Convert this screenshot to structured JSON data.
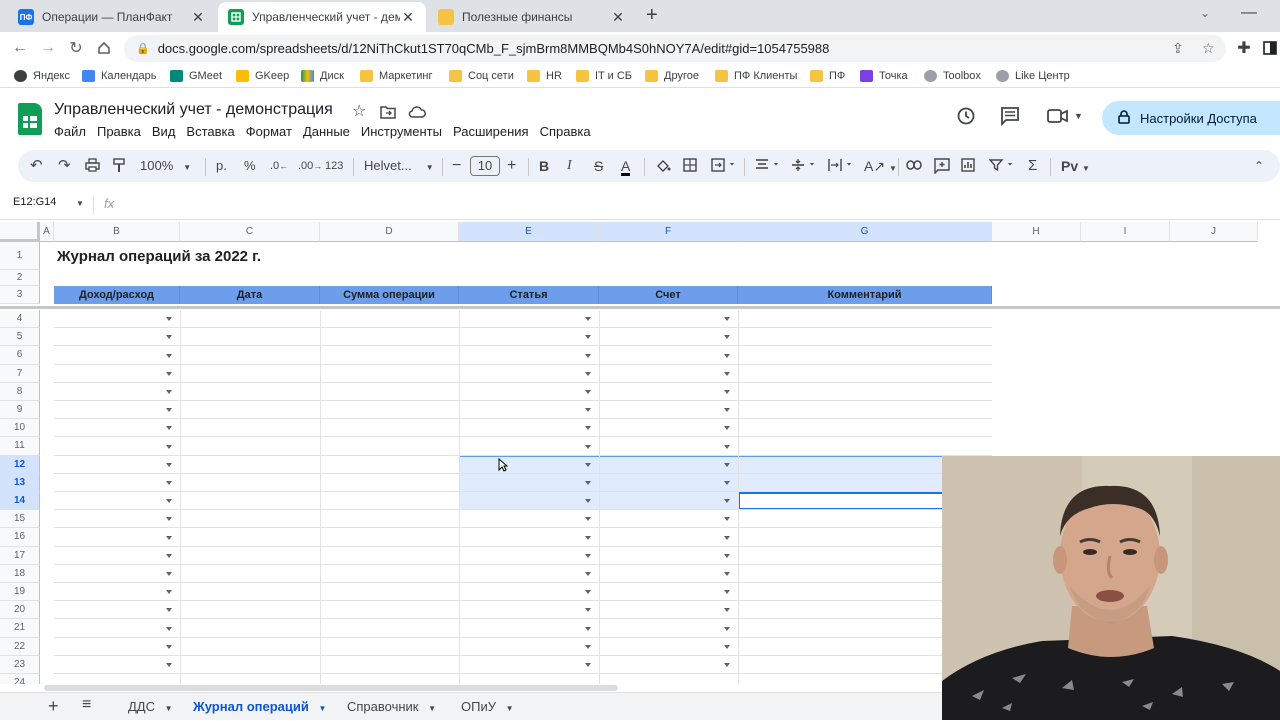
{
  "browser": {
    "tabs": [
      {
        "title": "Операции — ПланФакт",
        "favicon": "ПФ",
        "active": false
      },
      {
        "title": "Управленческий учет - демонс",
        "favicon": "sheets",
        "active": true
      },
      {
        "title": "Полезные финансы",
        "favicon": "folder",
        "active": false
      }
    ],
    "new_tab": "+",
    "url": "docs.google.com/spreadsheets/d/12NiThCkut1ST70qCMb_F_sjmBrm8MMBQMb4S0hNOY7A/edit#gid=1054755988",
    "bookmarks": [
      {
        "label": "Яндекс",
        "icon": "globe-icon"
      },
      {
        "label": "Календарь",
        "icon": "calendar-icon"
      },
      {
        "label": "GMeet",
        "icon": "meet-icon"
      },
      {
        "label": "GKeep",
        "icon": "keep-icon"
      },
      {
        "label": "Диск",
        "icon": "drive-icon"
      },
      {
        "label": "Маркетинг",
        "icon": "folder-icon"
      },
      {
        "label": "Соц сети",
        "icon": "folder-icon"
      },
      {
        "label": "HR",
        "icon": "folder-icon"
      },
      {
        "label": "IT и СБ",
        "icon": "folder-icon"
      },
      {
        "label": "Другое",
        "icon": "folder-icon"
      },
      {
        "label": "ПФ Клиенты",
        "icon": "folder-icon"
      },
      {
        "label": "ПФ",
        "icon": "folder-icon"
      },
      {
        "label": "Точка",
        "icon": "tochka-icon"
      },
      {
        "label": "Toolbox",
        "icon": "globe-icon"
      },
      {
        "label": "Like Центр",
        "icon": "globe-icon"
      }
    ]
  },
  "sheets": {
    "doc_title": "Управленческий учет - демонстрация",
    "menu": [
      "Файл",
      "Правка",
      "Вид",
      "Вставка",
      "Формат",
      "Данные",
      "Инструменты",
      "Расширения",
      "Справка"
    ],
    "share_label": "Настройки Доступа",
    "toolbar": {
      "zoom": "100%",
      "currency": "р.",
      "percent": "%",
      "dec_decrease": ".0",
      "dec_increase": ".00",
      "number_format": "123",
      "font": "Helvet...",
      "font_size": "10"
    },
    "name_box": "E12:G14",
    "fx": "fx"
  },
  "grid": {
    "columns": [
      "A",
      "B",
      "C",
      "D",
      "E",
      "F",
      "G",
      "H",
      "I",
      "J"
    ],
    "selected_columns": [
      "E",
      "F",
      "G"
    ],
    "rows": [
      "1",
      "2",
      "3",
      "4",
      "5",
      "6",
      "7",
      "8",
      "9",
      "10",
      "11",
      "12",
      "13",
      "14",
      "15",
      "16",
      "17",
      "18",
      "19",
      "20",
      "21",
      "22",
      "23",
      "24"
    ],
    "selected_rows": [
      "12",
      "13",
      "14"
    ],
    "sheet_title": "Журнал операций за 2022 г.",
    "table_headers": [
      "Доход/расход",
      "Дата",
      "Сумма операции",
      "Статья",
      "Счет",
      "Комментарий"
    ],
    "header_color": "#6d9eeb",
    "selection_color": "#d3e3fd"
  },
  "sheet_tabs": [
    {
      "label": "ДДС",
      "active": false
    },
    {
      "label": "Журнал операций",
      "active": true
    },
    {
      "label": "Справочник",
      "active": false
    },
    {
      "label": "ОПиУ",
      "active": false
    }
  ]
}
